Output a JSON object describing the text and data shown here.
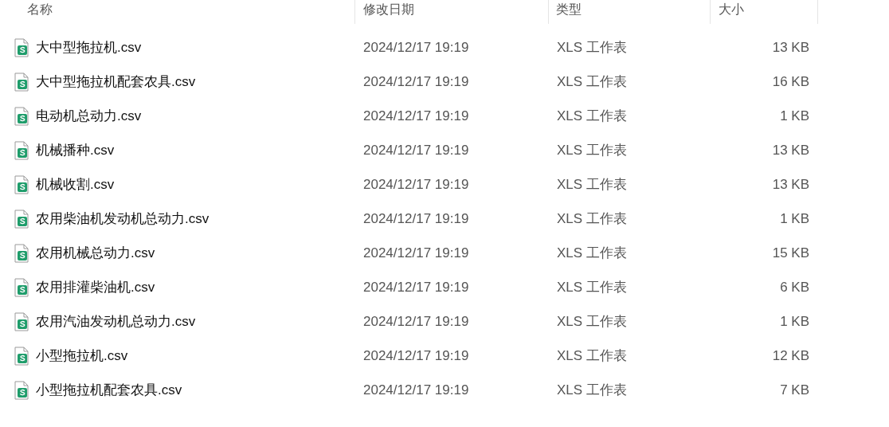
{
  "columns": [
    "名称",
    "修改日期",
    "类型",
    "大小"
  ],
  "files": [
    {
      "name": "大中型拖拉机.csv",
      "modified": "2024/12/17 19:19",
      "type": "XLS 工作表",
      "size": "13 KB"
    },
    {
      "name": "大中型拖拉机配套农具.csv",
      "modified": "2024/12/17 19:19",
      "type": "XLS 工作表",
      "size": "16 KB"
    },
    {
      "name": "电动机总动力.csv",
      "modified": "2024/12/17 19:19",
      "type": "XLS 工作表",
      "size": "1 KB"
    },
    {
      "name": "机械播种.csv",
      "modified": "2024/12/17 19:19",
      "type": "XLS 工作表",
      "size": "13 KB"
    },
    {
      "name": "机械收割.csv",
      "modified": "2024/12/17 19:19",
      "type": "XLS 工作表",
      "size": "13 KB"
    },
    {
      "name": "农用柴油机发动机总动力.csv",
      "modified": "2024/12/17 19:19",
      "type": "XLS 工作表",
      "size": "1 KB"
    },
    {
      "name": "农用机械总动力.csv",
      "modified": "2024/12/17 19:19",
      "type": "XLS 工作表",
      "size": "15 KB"
    },
    {
      "name": "农用排灌柴油机.csv",
      "modified": "2024/12/17 19:19",
      "type": "XLS 工作表",
      "size": "6 KB"
    },
    {
      "name": "农用汽油发动机总动力.csv",
      "modified": "2024/12/17 19:19",
      "type": "XLS 工作表",
      "size": "1 KB"
    },
    {
      "name": "小型拖拉机.csv",
      "modified": "2024/12/17 19:19",
      "type": "XLS 工作表",
      "size": "12 KB"
    },
    {
      "name": "小型拖拉机配套农具.csv",
      "modified": "2024/12/17 19:19",
      "type": "XLS 工作表",
      "size": "7 KB"
    }
  ]
}
